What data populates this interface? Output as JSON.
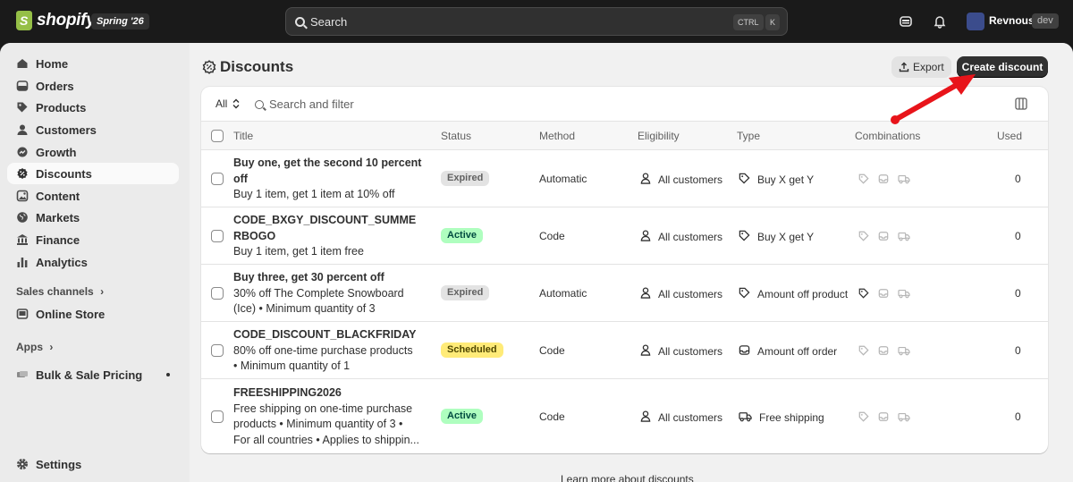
{
  "topbar": {
    "brand": "shopify",
    "edition": "Spring '26",
    "search_placeholder": "Search",
    "shortcut_key1": "CTRL",
    "shortcut_key2": "K",
    "user_name": "Revnous",
    "user_badge": "dev"
  },
  "sidebar": {
    "items": [
      {
        "label": "Home",
        "icon": "home-icon"
      },
      {
        "label": "Orders",
        "icon": "orders-icon"
      },
      {
        "label": "Products",
        "icon": "tag-icon"
      },
      {
        "label": "Customers",
        "icon": "person-icon"
      },
      {
        "label": "Growth",
        "icon": "growth-icon"
      },
      {
        "label": "Discounts",
        "icon": "discount-icon"
      },
      {
        "label": "Content",
        "icon": "content-icon"
      },
      {
        "label": "Markets",
        "icon": "globe-icon"
      },
      {
        "label": "Finance",
        "icon": "bank-icon"
      },
      {
        "label": "Analytics",
        "icon": "chart-icon"
      }
    ],
    "sales_channels_label": "Sales channels",
    "online_store_label": "Online Store",
    "apps_label": "Apps",
    "app_item_label": "Bulk & Sale Pricing",
    "settings_label": "Settings"
  },
  "page": {
    "title": "Discounts",
    "export_label": "Export",
    "create_label": "Create discount",
    "filter_all": "All",
    "search_filter_placeholder": "Search and filter",
    "footer_link": "Learn more about discounts"
  },
  "table": {
    "columns": [
      "Title",
      "Status",
      "Method",
      "Eligibility",
      "Type",
      "Combinations",
      "Used"
    ],
    "rows": [
      {
        "title_lines": [
          "Buy one, get the second 10 percent",
          "off"
        ],
        "sub_lines": [
          "Buy 1 item, get 1 item at 10% off"
        ],
        "status": "Expired",
        "status_kind": "expired",
        "method": "Automatic",
        "eligibility": "All customers",
        "type": "Buy X get Y",
        "type_icon": "tag-icon",
        "used": "0"
      },
      {
        "title_lines": [
          "CODE_BXGY_DISCOUNT_SUMME",
          "RBOGO"
        ],
        "sub_lines": [
          "Buy 1 item, get 1 item free"
        ],
        "status": "Active",
        "status_kind": "active",
        "method": "Code",
        "eligibility": "All customers",
        "type": "Buy X get Y",
        "type_icon": "tag-icon",
        "used": "0"
      },
      {
        "title_lines": [
          "Buy three, get 30 percent off"
        ],
        "sub_lines": [
          "30% off The Complete Snowboard",
          "(Ice) • Minimum quantity of 3"
        ],
        "status": "Expired",
        "status_kind": "expired",
        "method": "Automatic",
        "eligibility": "All customers",
        "type": "Amount off product",
        "type_icon": "tag-icon",
        "used": "0"
      },
      {
        "title_lines": [
          "CODE_DISCOUNT_BLACKFRIDAY"
        ],
        "sub_lines": [
          "80% off one-time purchase products",
          "• Minimum quantity of 1"
        ],
        "status": "Scheduled",
        "status_kind": "scheduled",
        "method": "Code",
        "eligibility": "All customers",
        "type": "Amount off order",
        "type_icon": "order-icon",
        "used": "0"
      },
      {
        "title_lines": [
          "FREESHIPPING2026"
        ],
        "sub_lines": [
          "Free shipping on one-time purchase",
          "products • Minimum quantity of 3 •",
          "For all countries • Applies to shippin..."
        ],
        "status": "Active",
        "status_kind": "active",
        "method": "Code",
        "eligibility": "All customers",
        "type": "Free shipping",
        "type_icon": "truck-icon",
        "used": "0"
      }
    ]
  },
  "colors": {
    "topbar": "#1a1a1a",
    "annotation_arrow": "#e8141a",
    "active_badge": "#affebf",
    "scheduled_badge": "#ffeb78",
    "expired_badge": "#e3e3e3"
  }
}
